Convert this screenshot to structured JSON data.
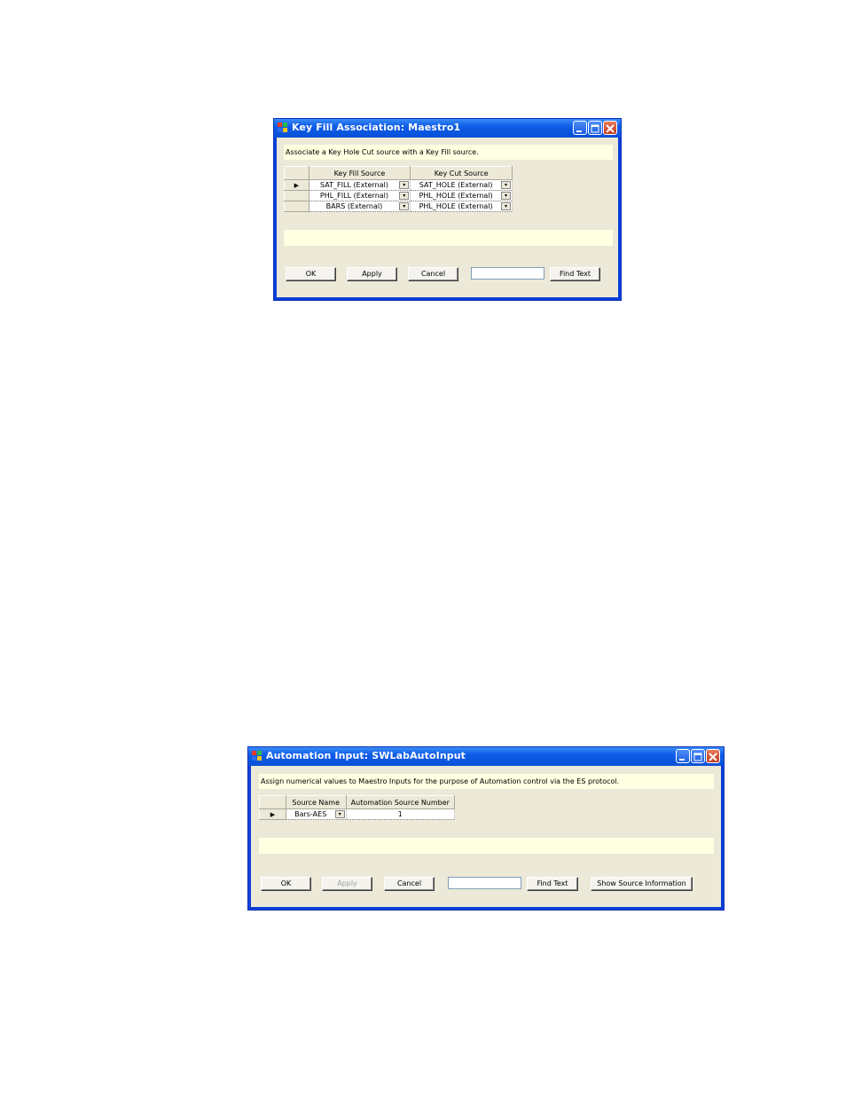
{
  "window1": {
    "title": "Key Fill Association: Maestro1",
    "hint": "Associate a Key Hole Cut source with a Key Fill source.",
    "columns": [
      "Key Fill Source",
      "Key Cut Source"
    ],
    "rows": [
      {
        "selector": "▶",
        "fill": "SAT_FILL (External)",
        "cut": "SAT_HOLE (External)"
      },
      {
        "selector": "",
        "fill": "PHL_FILL (External)",
        "cut": "PHL_HOLE (External)"
      },
      {
        "selector": "",
        "fill": "BARS (External)",
        "cut": "PHL_HOLE (External)"
      }
    ],
    "buttons": {
      "ok": "OK",
      "apply": "Apply",
      "cancel": "Cancel",
      "find": "Find Text"
    },
    "find_value": ""
  },
  "window2": {
    "title": "Automation Input: SWLabAutoInput",
    "hint": "Assign numerical values to Maestro Inputs for the purpose of Automation control via the ES protocol.",
    "columns": [
      "Source Name",
      "Automation Source Number"
    ],
    "rows": [
      {
        "selector": "▶",
        "name": "Bars-AES",
        "number": "1"
      }
    ],
    "buttons": {
      "ok": "OK",
      "apply": "Apply",
      "cancel": "Cancel",
      "find": "Find Text",
      "show": "Show Source Information"
    },
    "find_value": ""
  },
  "icons": {
    "dropdown": "▾",
    "minimize": "minimize-icon",
    "maximize": "maximize-icon",
    "close": "close-icon",
    "app": "app-icon"
  },
  "colors": {
    "title_blue": "#0851d6",
    "hint_bg": "#ffffe1",
    "client_bg": "#ece9d8"
  }
}
